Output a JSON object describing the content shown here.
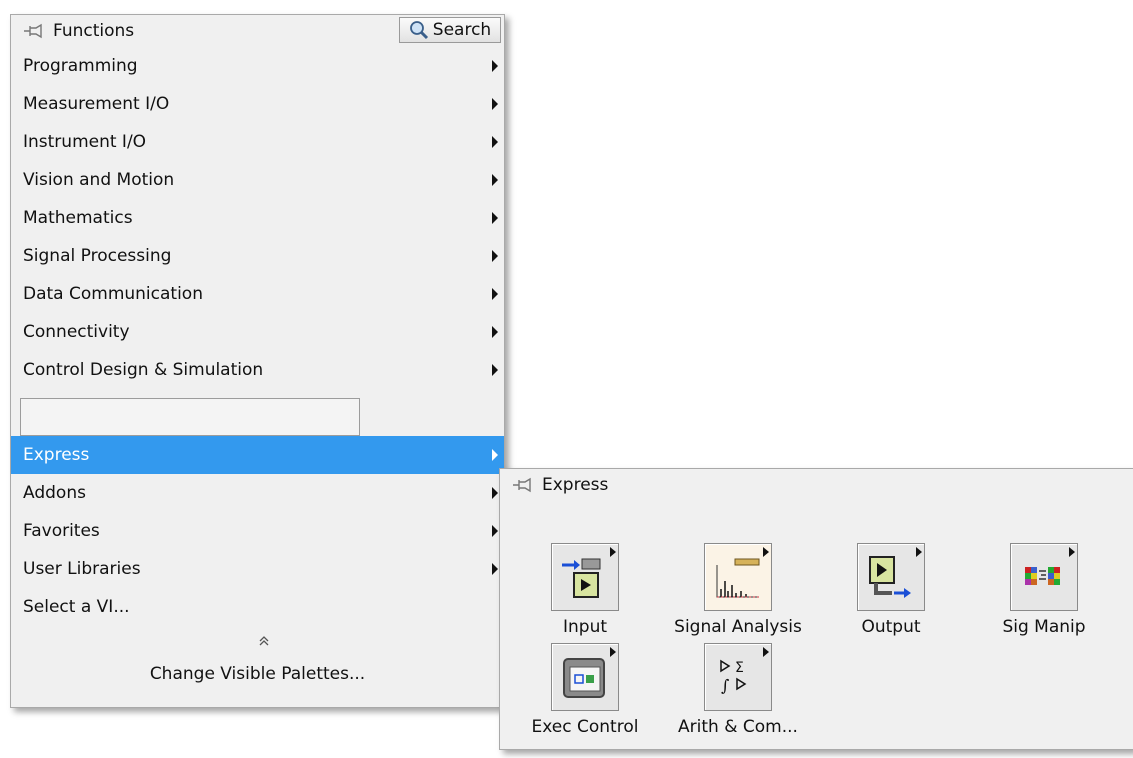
{
  "functions_palette": {
    "title": "Functions",
    "search_label": "Search",
    "items": [
      {
        "label": "Programming",
        "submenu": true
      },
      {
        "label": "Measurement I/O",
        "submenu": true
      },
      {
        "label": "Instrument I/O",
        "submenu": true
      },
      {
        "label": "Vision and Motion",
        "submenu": true
      },
      {
        "label": "Mathematics",
        "submenu": true
      },
      {
        "label": "Signal Processing",
        "submenu": true
      },
      {
        "label": "Data Communication",
        "submenu": true
      },
      {
        "label": "Connectivity",
        "submenu": true
      },
      {
        "label": "Control Design & Simulation",
        "submenu": true
      }
    ],
    "express_label": "Express",
    "lower_items": [
      {
        "label": "Addons",
        "submenu": true
      },
      {
        "label": "Favorites",
        "submenu": true
      },
      {
        "label": "User Libraries",
        "submenu": true
      },
      {
        "label": "Select a VI...",
        "submenu": false
      }
    ],
    "collapse_glyph": "≈",
    "change_palettes_label": "Change Visible Palettes...",
    "selected_color": "#3399ee"
  },
  "express_palette": {
    "title": "Express",
    "tiles": [
      {
        "label": "Input",
        "icon": "input-icon"
      },
      {
        "label": "Signal Analysis",
        "icon": "signal-analysis-icon"
      },
      {
        "label": "Output",
        "icon": "output-icon"
      },
      {
        "label": "Sig Manip",
        "icon": "sig-manip-icon"
      },
      {
        "label": "Exec Control",
        "icon": "exec-control-icon"
      },
      {
        "label": "Arith & Com...",
        "icon": "arith-compare-icon"
      }
    ]
  }
}
